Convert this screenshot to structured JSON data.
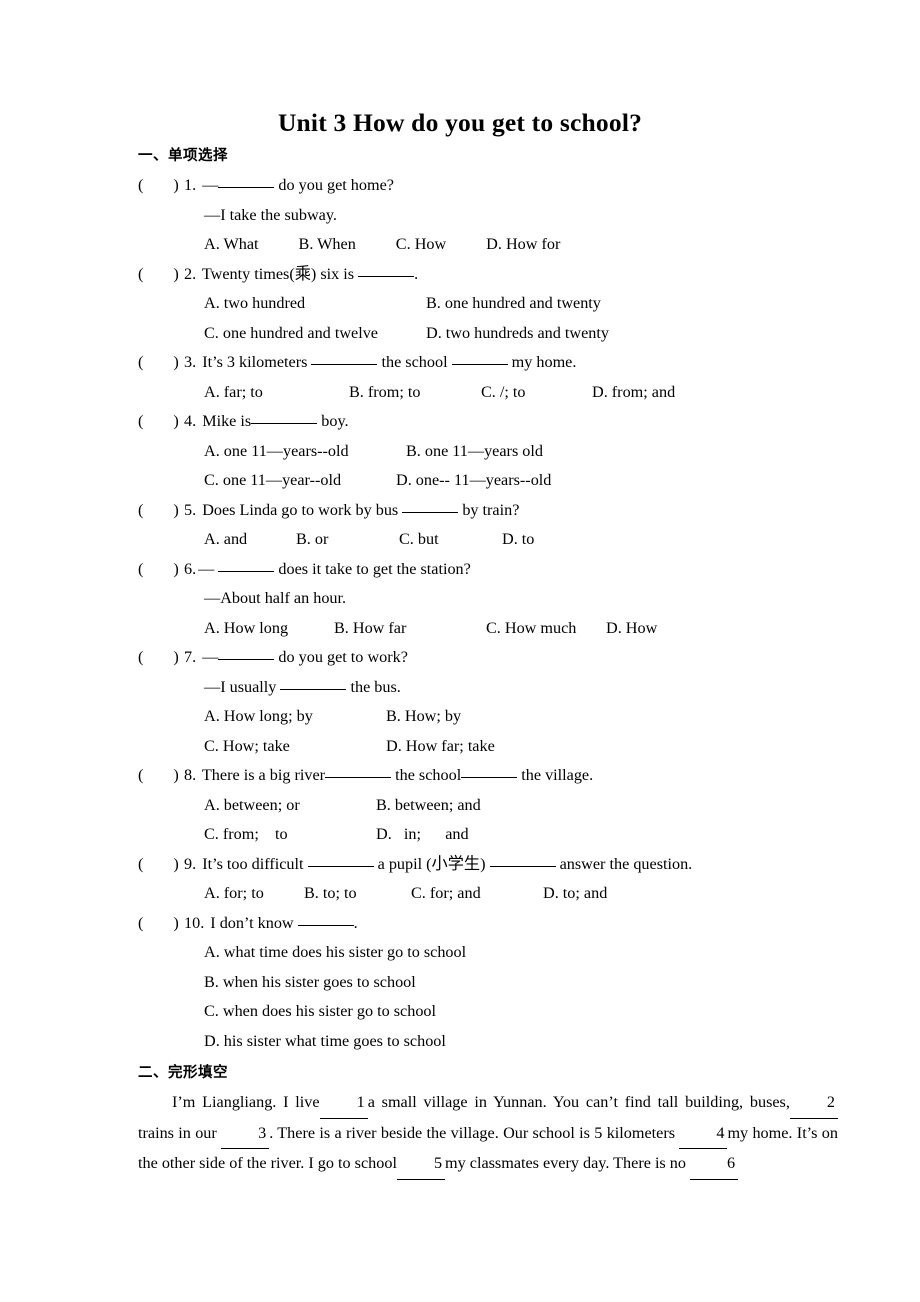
{
  "document": {
    "title": "Unit 3 How do you get to school?",
    "sections": [
      {
        "heading": "一、单项选择",
        "type": "multiple-choice",
        "questions": [
          {
            "number": "1.",
            "stem_lines": [
              "—______ do you get home?",
              "—I take the subway."
            ],
            "stem_prefix": "—",
            "stem_suffix": " do you get home?",
            "reply": "—I take the subway.",
            "options": [
              "A. What",
              "B. When",
              "C. How",
              "D. How for"
            ],
            "option_layout": "one-line-4"
          },
          {
            "number": "2.",
            "stem_prefix": "Twenty times(乘) six is ",
            "stem_suffix": ".",
            "options": [
              "A. two hundred",
              "B. one hundred and twenty",
              "C. one hundred and twelve",
              "D. two hundreds and twenty"
            ],
            "option_layout": "two-by-two"
          },
          {
            "number": "3.",
            "stem_parts": [
              "It’s 3 kilometers ",
              " the school ",
              " my home."
            ],
            "options": [
              "A. far; to",
              "B. from; to",
              "C. /; to",
              "D. from; and"
            ],
            "option_layout": "one-line-4"
          },
          {
            "number": "4.",
            "stem_parts": [
              "Mike is",
              " boy."
            ],
            "options": [
              "A. one 11—years--old",
              "B.   one 11—years   old",
              "C. one 11—year--old",
              "D. one-- 11—years--old"
            ],
            "option_layout": "two-by-two"
          },
          {
            "number": "5.",
            "stem_parts": [
              "Does Linda go to work by bus ",
              " by train?"
            ],
            "options": [
              "A. and",
              "B. or",
              "C. but",
              "D. to"
            ],
            "option_layout": "one-line-4"
          },
          {
            "number": "6.",
            "stem_prefix": "—",
            "stem_suffix": " does it take to get the station?",
            "reply": "—About half an hour.",
            "options": [
              "A. How long",
              "B. How far",
              "C. How much",
              "D. How"
            ],
            "option_layout": "one-line-4"
          },
          {
            "number": "7.",
            "stem_prefix": "—",
            "stem_suffix": " do you get to work?",
            "reply_parts": [
              "—I usually ",
              " the bus."
            ],
            "options": [
              "A. How long; by",
              "B. How; by",
              "C. How; take",
              "D. How far; take"
            ],
            "option_layout": "two-by-two"
          },
          {
            "number": "8.",
            "stem_parts": [
              "There is a big river",
              " the school",
              " the village."
            ],
            "options": [
              "A. between; or",
              "B. between; and",
              "C. from;    to",
              "D.   in;      and"
            ],
            "option_layout": "two-by-two"
          },
          {
            "number": "9.",
            "stem_parts": [
              "It’s too difficult ",
              " a pupil (小学生) ",
              " answer the question."
            ],
            "options": [
              "A. for; to",
              "B. to; to",
              "C. for; and",
              "D. to; and"
            ],
            "option_layout": "one-line-4"
          },
          {
            "number": "10.",
            "stem_parts": [
              "I don’t know ",
              "."
            ],
            "options": [
              "A. what time does his sister go to school",
              "B. when his sister goes to school",
              "C. when does his sister go to school",
              "D. his sister what time goes to school"
            ],
            "option_layout": "stacked"
          }
        ]
      },
      {
        "heading": "二、完形填空",
        "type": "cloze",
        "passage_segments": [
          "I’m Liangliang. I live",
          "1",
          "a small village in Yunnan. You can’t find tall building, buses,",
          "2",
          "trains in our ",
          "3",
          ". There is a river beside the village. Our school is 5 kilometers ",
          "4",
          "my home. It’s on the other side of the river. I go to school",
          "5",
          "my classmates every day. There is no ",
          "6"
        ]
      }
    ]
  }
}
